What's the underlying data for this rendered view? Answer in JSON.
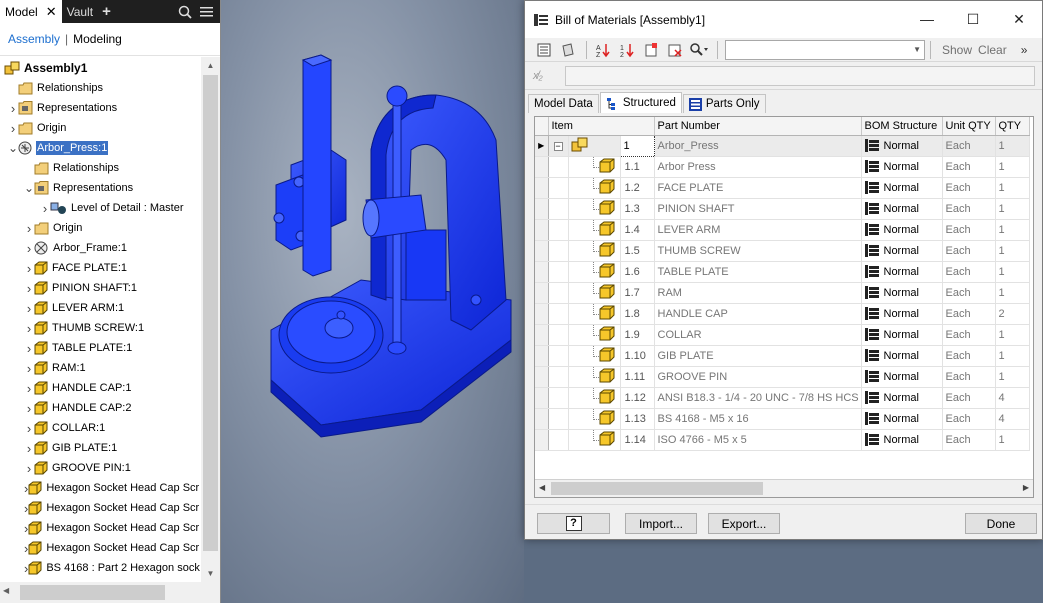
{
  "browser": {
    "tab_model": "Model",
    "tab_vault": "Vault",
    "subtab_assembly": "Assembly",
    "subtab_modeling": "Modeling",
    "tree": [
      {
        "label": "Assembly1",
        "level": 0,
        "icon": "assembly-icon",
        "expander": "none"
      },
      {
        "label": "Relationships",
        "level": 1,
        "icon": "folder-icon",
        "expander": "none"
      },
      {
        "label": "Representations",
        "level": 1,
        "icon": "representations-icon",
        "expander": "collapsed"
      },
      {
        "label": "Origin",
        "level": 1,
        "icon": "folder-icon",
        "expander": "collapsed"
      },
      {
        "label": "Arbor_Press:1",
        "level": 1,
        "icon": "subassembly-icon",
        "expander": "expanded",
        "selected": true
      },
      {
        "label": "Relationships",
        "level": 2,
        "icon": "folder-icon",
        "expander": "none"
      },
      {
        "label": "Representations",
        "level": 2,
        "icon": "representations-icon",
        "expander": "expanded"
      },
      {
        "label": "Level of Detail : Master",
        "level": 3,
        "icon": "level-of-detail-icon",
        "expander": "collapsed"
      },
      {
        "label": "Origin",
        "level": 2,
        "icon": "folder-icon",
        "expander": "collapsed"
      },
      {
        "label": "Arbor_Frame:1",
        "level": 2,
        "icon": "frame-part-icon",
        "expander": "collapsed"
      },
      {
        "label": "FACE PLATE:1",
        "level": 2,
        "icon": "part-icon",
        "expander": "collapsed"
      },
      {
        "label": "PINION SHAFT:1",
        "level": 2,
        "icon": "part-icon",
        "expander": "collapsed"
      },
      {
        "label": "LEVER ARM:1",
        "level": 2,
        "icon": "part-icon",
        "expander": "collapsed"
      },
      {
        "label": "THUMB SCREW:1",
        "level": 2,
        "icon": "part-icon",
        "expander": "collapsed"
      },
      {
        "label": "TABLE PLATE:1",
        "level": 2,
        "icon": "part-icon",
        "expander": "collapsed"
      },
      {
        "label": "RAM:1",
        "level": 2,
        "icon": "part-icon",
        "expander": "collapsed"
      },
      {
        "label": "HANDLE CAP:1",
        "level": 2,
        "icon": "part-icon",
        "expander": "collapsed"
      },
      {
        "label": "HANDLE CAP:2",
        "level": 2,
        "icon": "part-icon",
        "expander": "collapsed"
      },
      {
        "label": "COLLAR:1",
        "level": 2,
        "icon": "part-icon",
        "expander": "collapsed"
      },
      {
        "label": "GIB PLATE:1",
        "level": 2,
        "icon": "part-icon",
        "expander": "collapsed"
      },
      {
        "label": "GROOVE PIN:1",
        "level": 2,
        "icon": "part-icon",
        "expander": "collapsed"
      },
      {
        "label": "Hexagon Socket Head Cap Scr",
        "level": 2,
        "icon": "part-icon",
        "expander": "collapsed"
      },
      {
        "label": "Hexagon Socket Head Cap Scr",
        "level": 2,
        "icon": "part-icon",
        "expander": "collapsed"
      },
      {
        "label": "Hexagon Socket Head Cap Scr",
        "level": 2,
        "icon": "part-icon",
        "expander": "collapsed"
      },
      {
        "label": "Hexagon Socket Head Cap Scr",
        "level": 2,
        "icon": "part-icon",
        "expander": "collapsed"
      },
      {
        "label": "BS 4168 : Part 2 Hexagon sock",
        "level": 2,
        "icon": "part-icon",
        "expander": "collapsed"
      }
    ]
  },
  "viewport": {
    "model_color": "#1a3cff"
  },
  "bom": {
    "title": "Bill of Materials [Assembly1]",
    "toolbar": {
      "show_label": "Show",
      "clear_label": "Clear"
    },
    "tabs": [
      {
        "label": "Model Data",
        "active": false
      },
      {
        "label": "Structured",
        "active": true
      },
      {
        "label": "Parts Only",
        "active": false
      }
    ],
    "columns": [
      "Item",
      "Part Number",
      "BOM Structure",
      "Unit QTY",
      "QTY"
    ],
    "rows": [
      {
        "item": "1",
        "part_number": "Arbor_Press",
        "bom_structure": "Normal",
        "unit_qty": "Each",
        "qty": "1",
        "type": "assembly"
      },
      {
        "item": "1.1",
        "part_number": "Arbor Press",
        "bom_structure": "Normal",
        "unit_qty": "Each",
        "qty": "1",
        "type": "part"
      },
      {
        "item": "1.2",
        "part_number": "FACE PLATE",
        "bom_structure": "Normal",
        "unit_qty": "Each",
        "qty": "1",
        "type": "part"
      },
      {
        "item": "1.3",
        "part_number": "PINION SHAFT",
        "bom_structure": "Normal",
        "unit_qty": "Each",
        "qty": "1",
        "type": "part"
      },
      {
        "item": "1.4",
        "part_number": "LEVER ARM",
        "bom_structure": "Normal",
        "unit_qty": "Each",
        "qty": "1",
        "type": "part"
      },
      {
        "item": "1.5",
        "part_number": "THUMB SCREW",
        "bom_structure": "Normal",
        "unit_qty": "Each",
        "qty": "1",
        "type": "part"
      },
      {
        "item": "1.6",
        "part_number": "TABLE PLATE",
        "bom_structure": "Normal",
        "unit_qty": "Each",
        "qty": "1",
        "type": "part"
      },
      {
        "item": "1.7",
        "part_number": "RAM",
        "bom_structure": "Normal",
        "unit_qty": "Each",
        "qty": "1",
        "type": "part"
      },
      {
        "item": "1.8",
        "part_number": "HANDLE CAP",
        "bom_structure": "Normal",
        "unit_qty": "Each",
        "qty": "2",
        "type": "part"
      },
      {
        "item": "1.9",
        "part_number": "COLLAR",
        "bom_structure": "Normal",
        "unit_qty": "Each",
        "qty": "1",
        "type": "part"
      },
      {
        "item": "1.10",
        "part_number": "GIB PLATE",
        "bom_structure": "Normal",
        "unit_qty": "Each",
        "qty": "1",
        "type": "part"
      },
      {
        "item": "1.11",
        "part_number": "GROOVE PIN",
        "bom_structure": "Normal",
        "unit_qty": "Each",
        "qty": "1",
        "type": "part"
      },
      {
        "item": "1.12",
        "part_number": "ANSI B18.3 - 1/4 - 20 UNC - 7/8 HS HCS",
        "bom_structure": "Normal",
        "unit_qty": "Each",
        "qty": "4",
        "type": "part"
      },
      {
        "item": "1.13",
        "part_number": "BS 4168 - M5 x 16",
        "bom_structure": "Normal",
        "unit_qty": "Each",
        "qty": "4",
        "type": "part"
      },
      {
        "item": "1.14",
        "part_number": "ISO 4766 - M5 x 5",
        "bom_structure": "Normal",
        "unit_qty": "Each",
        "qty": "1",
        "type": "part"
      }
    ],
    "footer": {
      "help_label": "?",
      "import_label": "Import...",
      "export_label": "Export...",
      "done_label": "Done"
    }
  }
}
